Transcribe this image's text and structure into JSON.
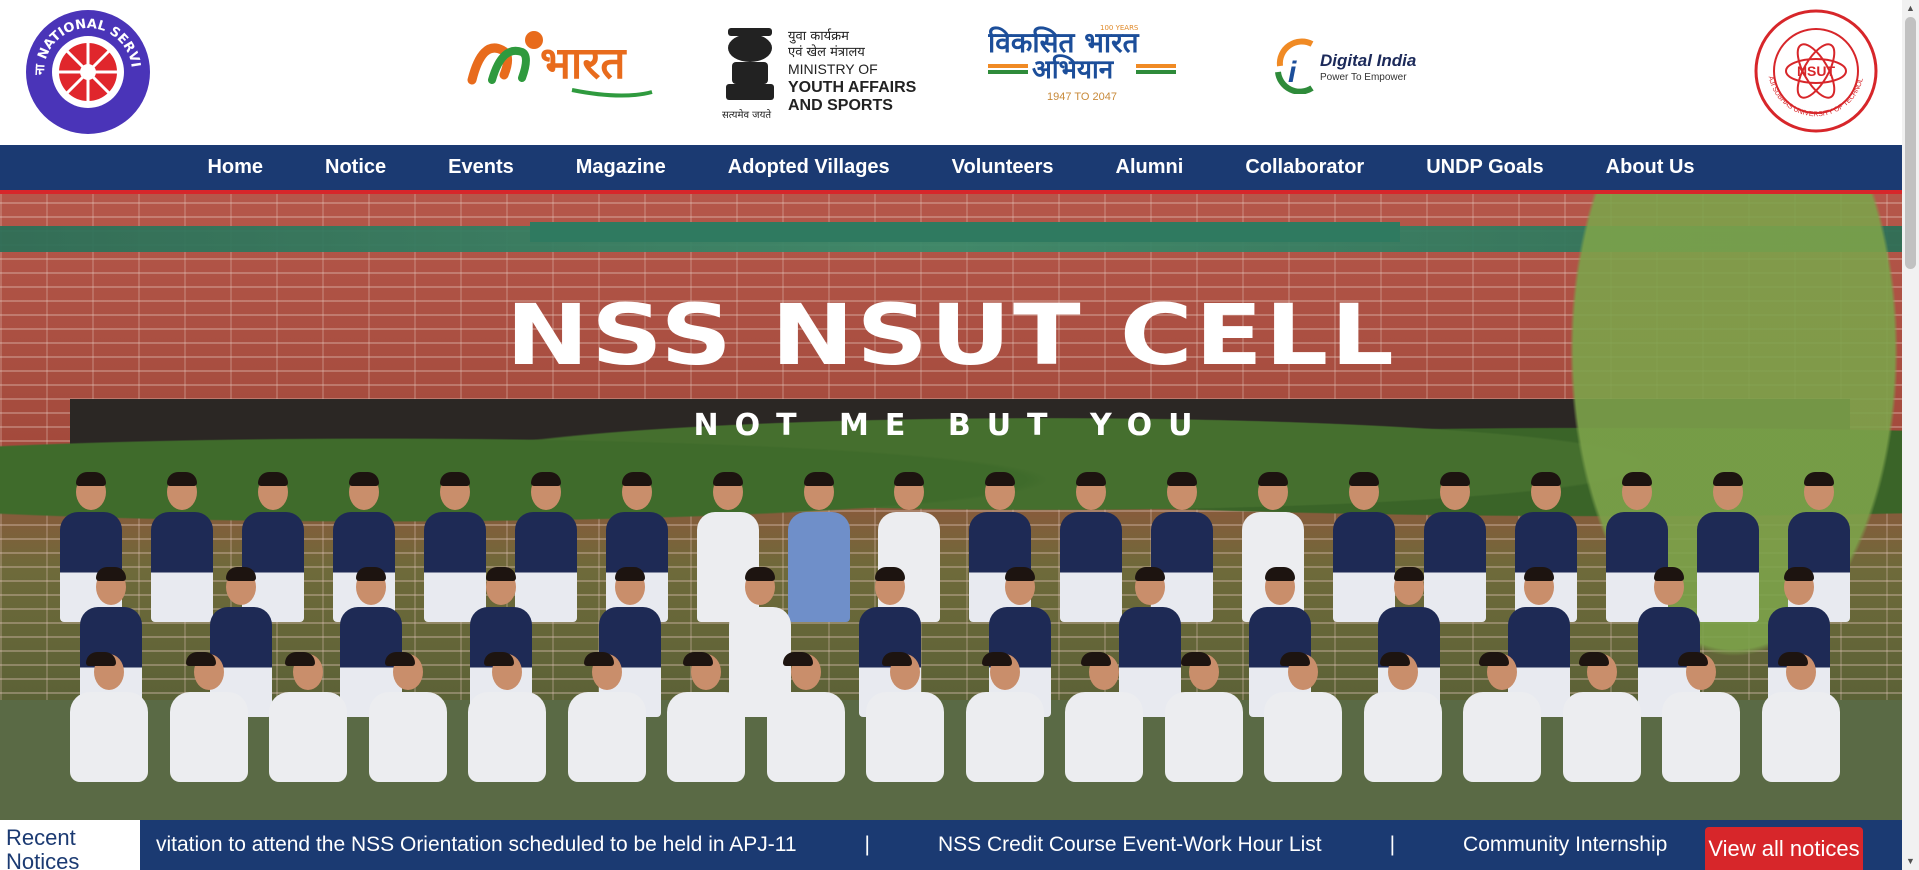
{
  "header": {
    "nss_logo": {
      "text": "राष्ट्रीय सेवा योजना NATIONAL SERVICE SCHEME"
    },
    "my_bharat": {
      "text": "भारत"
    },
    "ministry": {
      "line1": "युवा कार्यक्रम",
      "line2": "एवं खेल मंत्रालय",
      "line3": "MINISTRY OF",
      "line4": "YOUTH AFFAIRS",
      "line5": "AND SPORTS",
      "emblem_caption": "सत्यमेव जयते"
    },
    "viksit": {
      "line1": "विकसित भारत",
      "line2": "अभियान",
      "years": "1947 TO 2047",
      "badge": "100 YEARS"
    },
    "digital_india": {
      "title": "Digital India",
      "tagline": "Power To Empower"
    },
    "nsut_logo": {
      "center": "NSUT",
      "ring": "NETAJI SUBHAS UNIVERSITY OF TECHNOLOGY"
    }
  },
  "nav": {
    "items": [
      "Home",
      "Notice",
      "Events",
      "Magazine",
      "Adopted Villages",
      "Volunteers",
      "Alumni",
      "Collaborator",
      "UNDP Goals",
      "About Us"
    ]
  },
  "hero": {
    "title": "NSS NSUT CELL",
    "subtitle": "NOT ME BUT YOU"
  },
  "ticker": {
    "label": "Recent Notices",
    "items": [
      "vitation to attend the NSS Orientation scheduled to be held in APJ-11",
      "NSS Credit Course Event-Work Hour List",
      "Community Internship"
    ],
    "separator": "|",
    "view_all": "View all notices"
  },
  "colors": {
    "nav_bg": "#1b3a72",
    "accent_red": "#d7262a",
    "nss_blue": "#3b2aa0"
  }
}
